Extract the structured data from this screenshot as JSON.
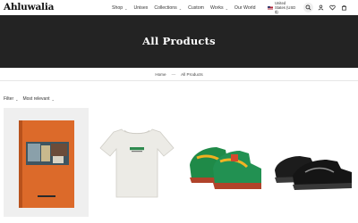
{
  "header": {
    "logo": "Ahluwalia",
    "nav": [
      {
        "label": "Shop",
        "has_dropdown": true
      },
      {
        "label": "Unisex",
        "has_dropdown": false
      },
      {
        "label": "Collections",
        "has_dropdown": true
      },
      {
        "label": "Custom",
        "has_dropdown": false
      },
      {
        "label": "Works",
        "has_dropdown": true
      },
      {
        "label": "Our World",
        "has_dropdown": false
      }
    ],
    "locale_lines": [
      "United",
      "States (USD",
      "$)"
    ],
    "icons": [
      "search-icon",
      "account-icon",
      "heart-icon",
      "cart-icon"
    ]
  },
  "hero": {
    "title": "All Products"
  },
  "breadcrumb": {
    "home": "Home",
    "separator": "—",
    "current": "All Products"
  },
  "filters": {
    "filter_label": "Filter",
    "sort_label": "Most relevant"
  },
  "products": [
    {
      "name": "orange book",
      "bg": "#efefef"
    },
    {
      "name": "white t-shirt",
      "bg": "#ffffff"
    },
    {
      "name": "green sneakers",
      "bg": "#ffffff"
    },
    {
      "name": "black sneakers",
      "bg": "#ffffff"
    }
  ],
  "colors": {
    "hero_bg": "#232323",
    "accent": "#1a1a1a"
  }
}
